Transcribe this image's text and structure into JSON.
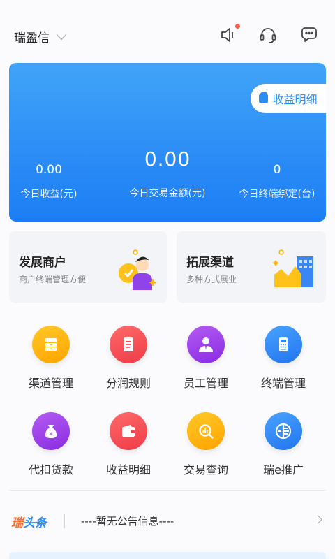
{
  "header": {
    "app_name": "瑞盈信",
    "icons": [
      "speaker-icon",
      "headset-icon",
      "chat-icon"
    ],
    "notification_dot_color": "#ff5a4e"
  },
  "earnings": {
    "detail_label": "收益明细",
    "today_income_value": "0.00",
    "today_income_label": "今日收益(元)",
    "today_trade_value": "0.00",
    "today_trade_label": "今日交易金额(元)",
    "today_bind_value": "0",
    "today_bind_label": "今日终端绑定(台)",
    "accent_color": "#2b8cf6"
  },
  "features": [
    {
      "title": "发展商户",
      "subtitle": "商户终端管理方便"
    },
    {
      "title": "拓展渠道",
      "subtitle": "多种方式展业"
    }
  ],
  "grid": [
    {
      "label": "渠道管理",
      "color": "#ffb400",
      "icon": "channel-icon"
    },
    {
      "label": "分润规则",
      "color": "#f5464e",
      "icon": "rules-icon"
    },
    {
      "label": "员工管理",
      "color": "#9f3ce8",
      "icon": "staff-icon"
    },
    {
      "label": "终端管理",
      "color": "#2f86f5",
      "icon": "terminal-icon"
    },
    {
      "label": "代扣货款",
      "color": "#9f3ce8",
      "icon": "money-bag-icon"
    },
    {
      "label": "收益明细",
      "color": "#f5464e",
      "icon": "wallet-icon"
    },
    {
      "label": "交易查询",
      "color": "#ffb400",
      "icon": "search-chart-icon"
    },
    {
      "label": "瑞e推广",
      "color": "#2f86f5",
      "icon": "promote-icon"
    }
  ],
  "notice": {
    "brand_part1": "瑞",
    "brand_part2": "头条",
    "message": "----暂无公告信息----"
  }
}
